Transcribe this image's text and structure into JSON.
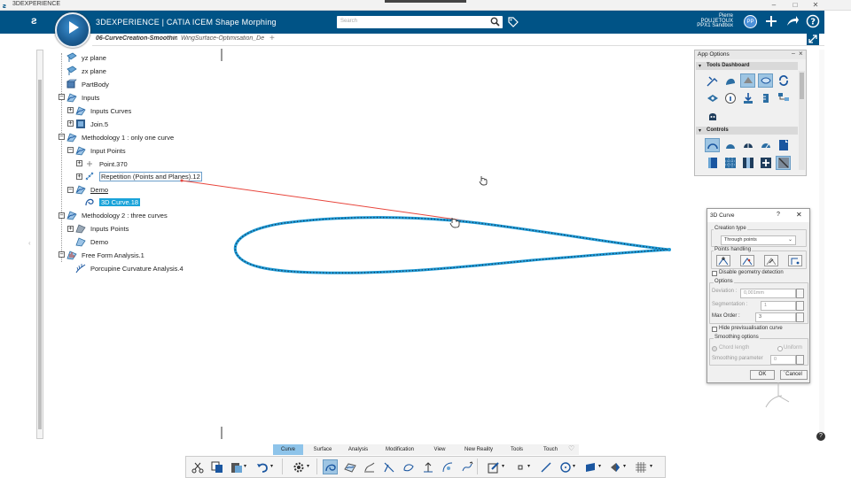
{
  "window": {
    "title": "3DEXPERIENCE",
    "minimize": "–",
    "maximize": "□",
    "close": "✕"
  },
  "app": {
    "brand": "3DEXPERIENCE | CATIA ICEM Shape Morphing",
    "search_placeholder": "Search",
    "user_name": "Pierre POUJETOUX",
    "tenant": "PPX1 Sandbox",
    "avatar_initials": "PP"
  },
  "tabs": [
    {
      "label": "06-CurveCreation-Smoothing"
    },
    {
      "label": "WingSurface-Optimisation_De"
    }
  ],
  "tree": [
    {
      "label": "yz plane"
    },
    {
      "label": "zx plane"
    },
    {
      "label": "PartBody"
    },
    {
      "label": "Inputs"
    },
    {
      "label": "Inputs Curves"
    },
    {
      "label": "Join.5"
    },
    {
      "label": "Methodology 1 : only one curve"
    },
    {
      "label": "Input Points"
    },
    {
      "label": "Point.370"
    },
    {
      "label": "Repetition (Points and Planes).12"
    },
    {
      "label": "Demo"
    },
    {
      "label": "3D Curve.18"
    },
    {
      "label": "Methodology 2 : three curves"
    },
    {
      "label": "Inputs Points"
    },
    {
      "label": "Demo"
    },
    {
      "label": "Free Form Analysis.1"
    },
    {
      "label": "Porcupine Curvature Analysis.4"
    }
  ],
  "app_options": {
    "title": "App Options",
    "tools_dashboard": "Tools Dashboard",
    "controls": "Controls"
  },
  "dialog": {
    "title": "3D Curve",
    "help": "?",
    "close": "✕",
    "creation_type_label": "Creation type",
    "creation_type_value": "Through points",
    "points_handling_label": "Points handling",
    "disable_geometry_detection": "Disable geometry detection",
    "options_label": "Options",
    "deviation_label": "Deviation :",
    "deviation_value": "0,001mm",
    "segmentation_label": "Segmentation :",
    "segmentation_value": "1",
    "max_order_label": "Max Order :",
    "max_order_value": "3",
    "hide_previsualisation": "Hide previsualisation curve",
    "smoothing_label": "Smoothing options",
    "chord_length": "Chord length",
    "uniform": "Uniform",
    "smoothing_parameter_label": "Smoothing parameter",
    "smoothing_parameter_value": "0",
    "ok": "OK",
    "cancel": "Cancel"
  },
  "section_tabs": [
    "Curve",
    "Surface",
    "Analysis",
    "Modification",
    "View",
    "New Reality",
    "Tools",
    "Touch"
  ],
  "active_section": "Curve",
  "colors": {
    "appbar": "#005386",
    "highlight": "#1aa3d9",
    "curve": "#1d9ad6",
    "rubber_band": "#e8453c"
  }
}
